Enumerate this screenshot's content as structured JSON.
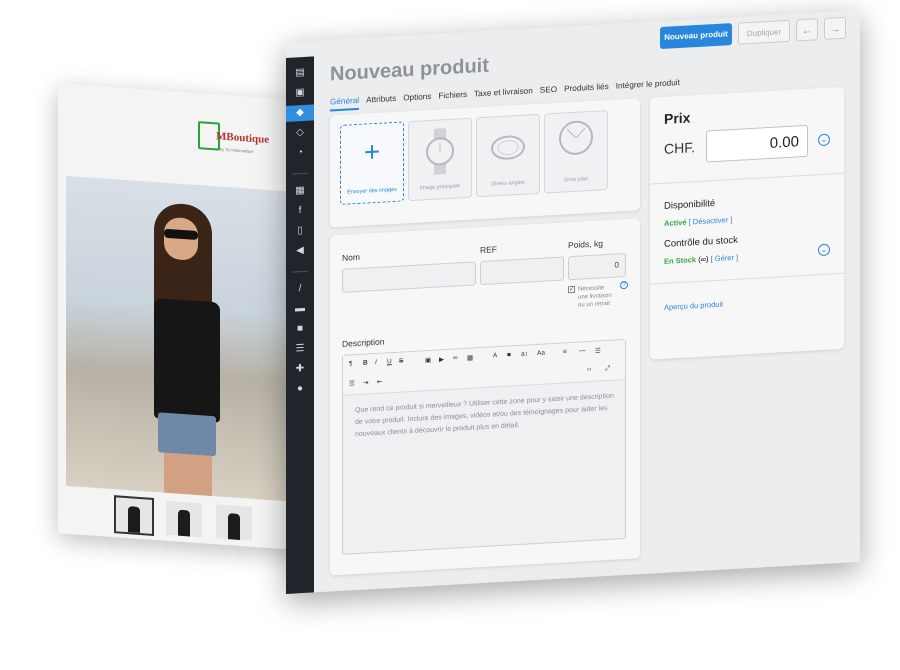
{
  "storefront": {
    "logo_brand": "MBoutique",
    "logo_sub": "by Tic informatique"
  },
  "admin": {
    "title": "Nouveau produit",
    "new_product_button": "Nouveau produit",
    "duplicate_button": "Dupliquer",
    "prev_glyph": "←",
    "next_glyph": "→",
    "tabs": [
      {
        "label": "Général"
      },
      {
        "label": "Attributs"
      },
      {
        "label": "Options"
      },
      {
        "label": "Fichiers"
      },
      {
        "label": "Taxe et livraison"
      },
      {
        "label": "SEO"
      },
      {
        "label": "Produits liés"
      },
      {
        "label": "Intégrer le produit"
      }
    ],
    "images": {
      "upload_label": "Envoyer des images",
      "main_image_label": "Image principale",
      "angles_label": "Divers angles",
      "closeup_label": "Gros plan"
    },
    "form": {
      "name_label": "Nom",
      "ref_label": "REF",
      "weight_label": "Poids, kg",
      "weight_value": "0",
      "shipping_line1": "Nécessite",
      "shipping_line2": "une livraison",
      "shipping_line3": "ou un retrait",
      "description_label": "Description",
      "description_placeholder": "Que rend ce produit si merveilleux ? Utiliser cette zone pour y saisir une description de votre produit. Inclure des images, vidéos et/ou des témoignages pour aider les nouveaux clients à découvrir le produit plus en détail."
    },
    "price": {
      "title": "Prix",
      "currency": "CHF.",
      "value": "0.00",
      "availability_title": "Disponibilité",
      "availability_status": "Activé",
      "availability_action": "[ Désactiver ]",
      "stock_title": "Contrôle du stock",
      "stock_status": "En Stock",
      "stock_qty": "(∞)",
      "stock_action": "[ Gérer ]",
      "preview_link": "Aperçu du produit"
    }
  }
}
